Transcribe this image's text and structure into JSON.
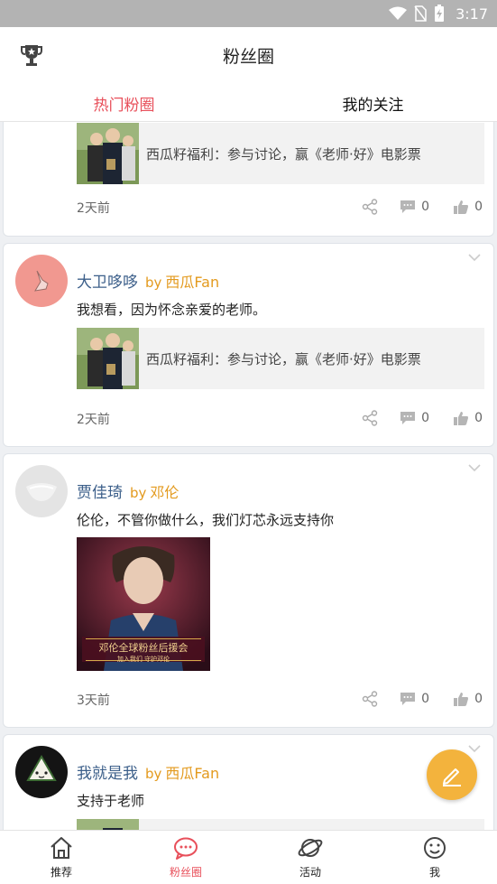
{
  "status_bar": {
    "time": "3:17"
  },
  "app_bar": {
    "title": "粉丝圈",
    "trophy_icon": "trophy-icon"
  },
  "tabs": [
    {
      "label": "热门粉圈",
      "active": true
    },
    {
      "label": "我的关注",
      "active": false
    }
  ],
  "posts": [
    {
      "link_text": "西瓜籽福利：参与讨论，赢《老师·好》电影票",
      "time": "2天前",
      "comments": "0",
      "likes": "0"
    },
    {
      "user": "大卫哆哆",
      "by": "by",
      "source": "西瓜Fan",
      "text": "我想看，因为怀念亲爱的老师。",
      "link_text": "西瓜籽福利：参与讨论，赢《老师·好》电影票",
      "time": "2天前",
      "comments": "0",
      "likes": "0"
    },
    {
      "user": "贾佳琦",
      "by": "by",
      "source": "邓伦",
      "text": "伦伦，不管你做什么，我们灯芯永远支持你",
      "image_caption": "邓伦全球粉丝后援会",
      "image_subcaption": "加入我们 守护邓伦",
      "time": "3天前",
      "comments": "0",
      "likes": "0"
    },
    {
      "user": "我就是我",
      "by": "by",
      "source": "西瓜Fan",
      "text": "支持于老师"
    }
  ],
  "fab": {
    "icon": "edit-icon"
  },
  "bottom_nav": [
    {
      "label": "推荐",
      "icon": "home-icon"
    },
    {
      "label": "粉丝圈",
      "icon": "chat-bubble-icon",
      "active": true
    },
    {
      "label": "活动",
      "icon": "planet-icon"
    },
    {
      "label": "我",
      "icon": "smiley-icon"
    }
  ],
  "colors": {
    "accent": "#e8505b",
    "username": "#3c5f8a",
    "source": "#e39a1e",
    "fab": "#f3b33d"
  }
}
